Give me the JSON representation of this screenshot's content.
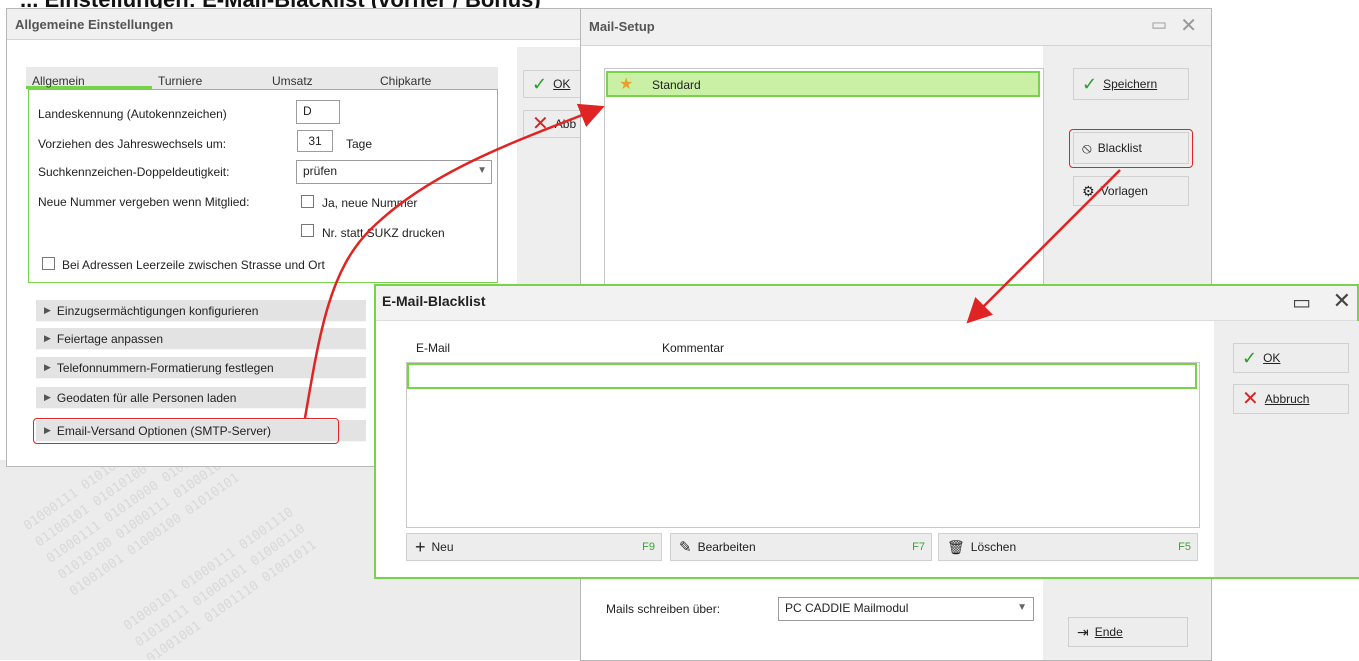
{
  "top_caption": "... Einstellungen: E-Mail-Blacklist (vorher / Bonus)",
  "main_window": {
    "title": "Allgemeine Einstellungen",
    "tabs": [
      "Allgemein",
      "Turniere",
      "Umsatz",
      "Chipkarte"
    ],
    "fields": {
      "landeskennung_label": "Landeskennung (Autokennzeichen)",
      "landeskennung_value": "D",
      "jahreswechsel_label": "Vorziehen des Jahreswechsels um:",
      "jahreswechsel_value": "31",
      "jahreswechsel_unit": "Tage",
      "suchkennzeichen_label": "Suchkennzeichen-Doppeldeutigkeit:",
      "suchkennzeichen_value": "prüfen",
      "neue_nummer_label": "Neue Nummer vergeben wenn Mitglied:",
      "neue_nummer_option": "Ja, neue Nummer",
      "nr_statt_option": "Nr. statt SUKZ drucken",
      "leerzeile_option": "Bei Adressen Leerzeile zwischen Strasse und Ort"
    },
    "sections": [
      "Einzugsermächtigungen konfigurieren",
      "Feiertage anpassen",
      "Telefonnummern-Formatierung festlegen",
      "Geodaten für alle Personen laden",
      "Email-Versand Optionen (SMTP-Server)"
    ],
    "buttons": {
      "ok": "OK",
      "abbruch": "Abb"
    }
  },
  "mail_setup": {
    "title": "Mail-Setup",
    "list_item": "Standard",
    "buttons": {
      "speichern": "Speichern",
      "blacklist": "Blacklist",
      "vorlagen": "Vorlagen",
      "ende": "Ende"
    },
    "mails_label": "Mails schreiben über:",
    "mails_value": "PC CADDIE Mailmodul"
  },
  "blacklist": {
    "title": "E-Mail-Blacklist",
    "col_email": "E-Mail",
    "col_kommentar": "Kommentar",
    "buttons": {
      "ok": "OK",
      "abbruch": "Abbruch"
    },
    "bottom": [
      {
        "label": "Neu",
        "key": "F9"
      },
      {
        "label": "Bearbeiten",
        "key": "F7"
      },
      {
        "label": "Löschen",
        "key": "F5"
      }
    ]
  }
}
